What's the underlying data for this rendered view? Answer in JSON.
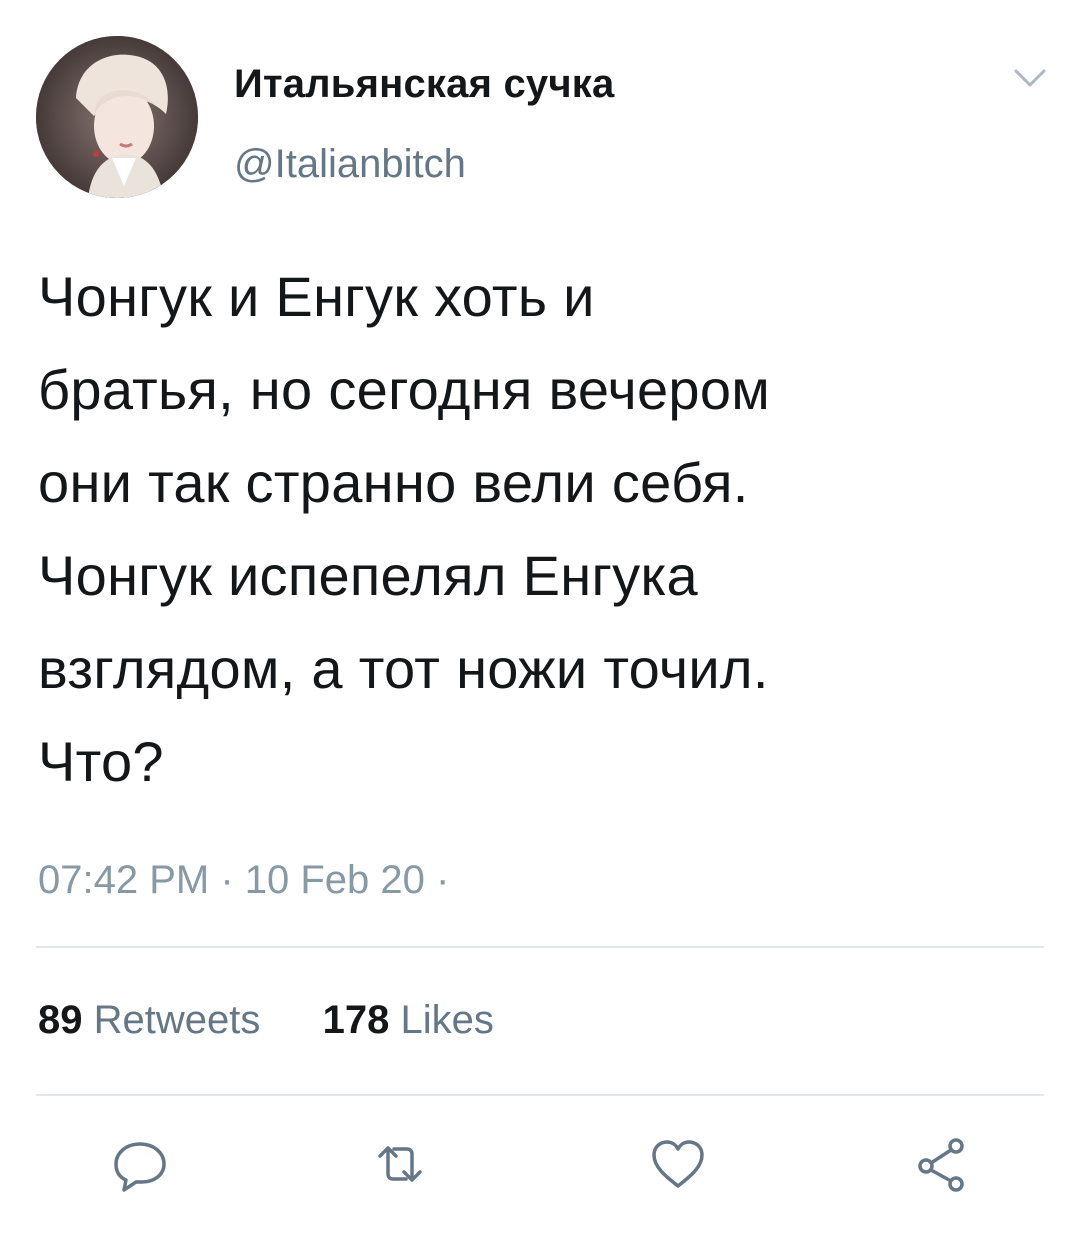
{
  "user": {
    "display_name": "Итальянская сучка",
    "handle": "@Italianbitch"
  },
  "tweet": {
    "text": "Чонгук и Енгук хоть и\nбратья, но сегодня вечером\nони так странно вели себя.\nЧонгук испепелял Енгука\nвзглядом, а тот ножи точил.\nЧто?",
    "timestamp": "07:42 PM · 10 Feb 20 ·"
  },
  "stats": {
    "retweets_count": "89",
    "retweets_label": "Retweets",
    "likes_count": "178",
    "likes_label": "Likes"
  },
  "icons": {
    "menu": "chevron-down-icon",
    "reply": "reply-icon",
    "retweet": "retweet-icon",
    "like": "heart-icon",
    "share": "share-icon"
  },
  "colors": {
    "text": "#14171a",
    "secondary": "#657786",
    "icon": "#657786",
    "divider": "#e1e8ed"
  }
}
